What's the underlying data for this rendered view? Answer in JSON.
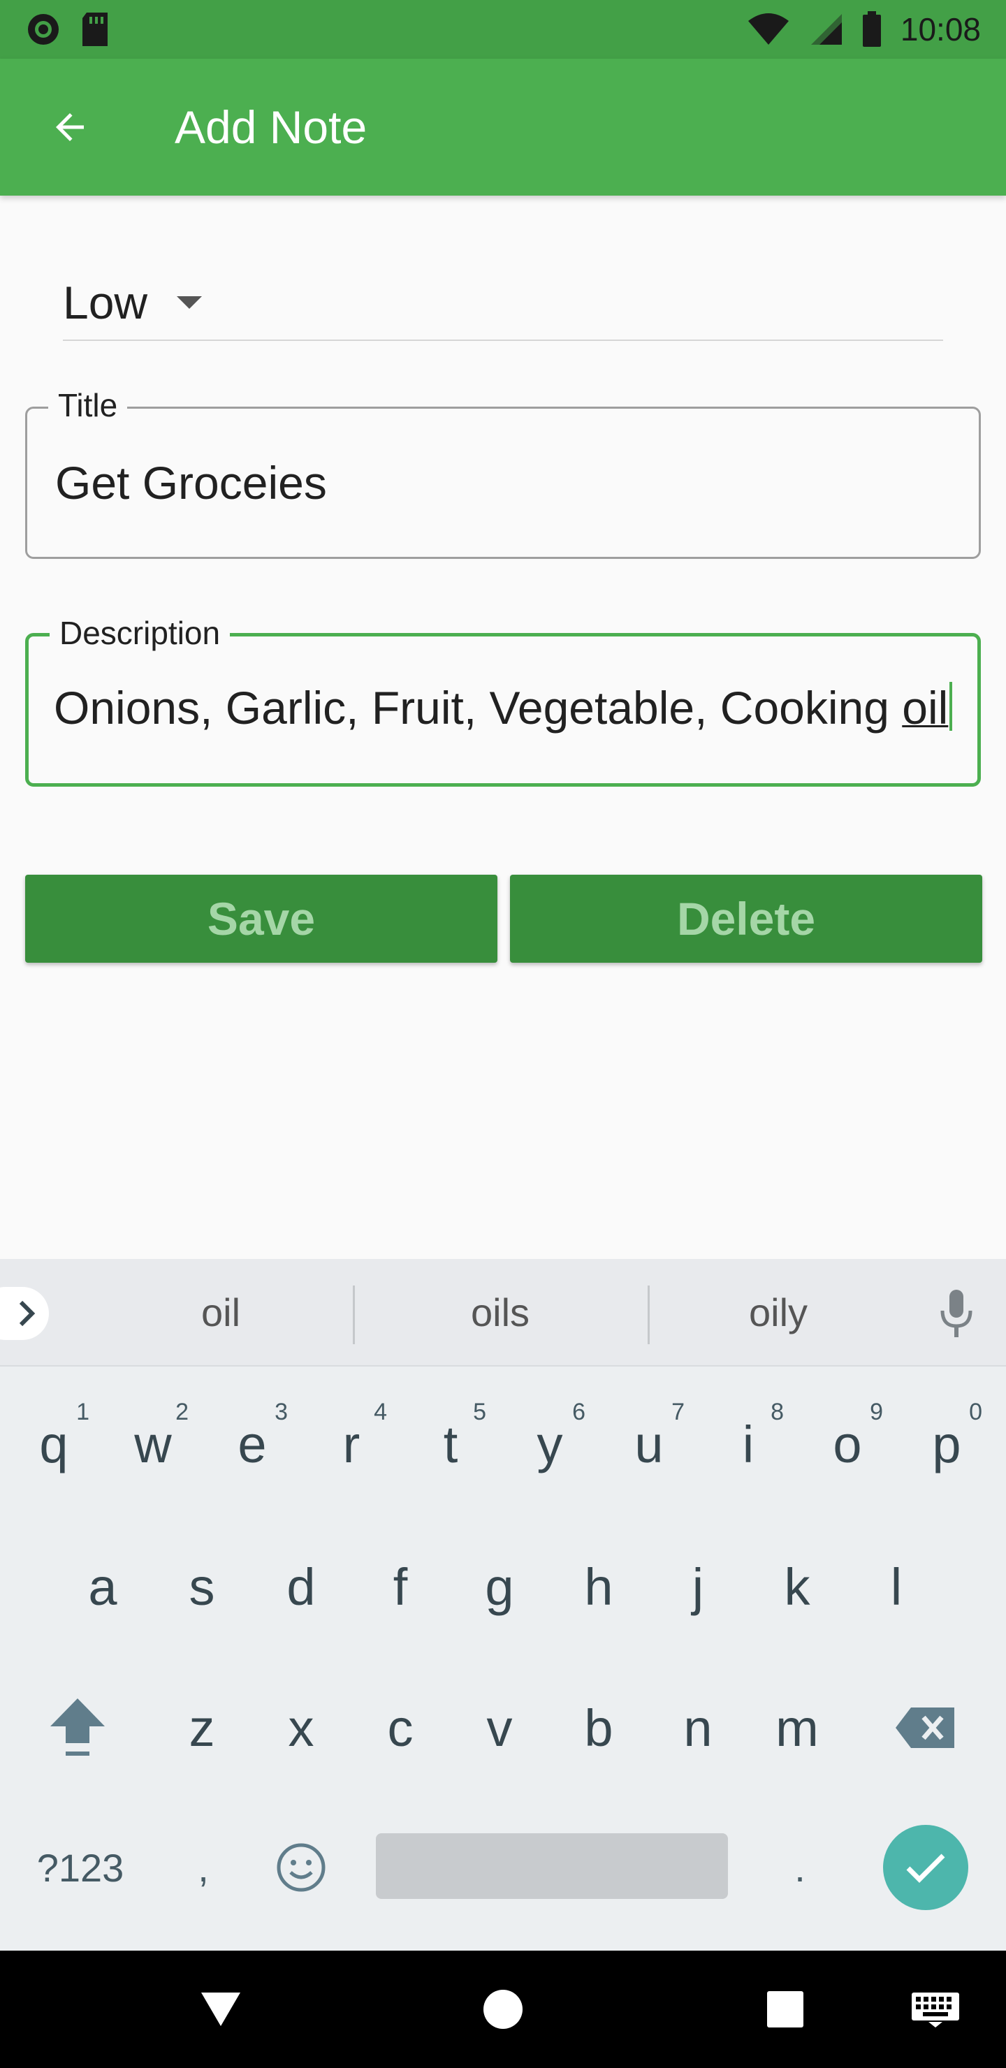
{
  "status_bar": {
    "time": "10:08"
  },
  "app_bar": {
    "title": "Add Note"
  },
  "priority": {
    "selected": "Low"
  },
  "title_field": {
    "label": "Title",
    "value": "Get Groceies"
  },
  "description_field": {
    "label": "Description",
    "value_plain": "Onions, Garlic, Fruit, Vegetable, Cooking ",
    "value_underlined": "oil"
  },
  "buttons": {
    "save": "Save",
    "delete": "Delete"
  },
  "keyboard": {
    "suggestions": [
      "oil",
      "oils",
      "oily"
    ],
    "row1": [
      {
        "key": "q",
        "hint": "1"
      },
      {
        "key": "w",
        "hint": "2"
      },
      {
        "key": "e",
        "hint": "3"
      },
      {
        "key": "r",
        "hint": "4"
      },
      {
        "key": "t",
        "hint": "5"
      },
      {
        "key": "y",
        "hint": "6"
      },
      {
        "key": "u",
        "hint": "7"
      },
      {
        "key": "i",
        "hint": "8"
      },
      {
        "key": "o",
        "hint": "9"
      },
      {
        "key": "p",
        "hint": "0"
      }
    ],
    "row2": [
      "a",
      "s",
      "d",
      "f",
      "g",
      "h",
      "j",
      "k",
      "l"
    ],
    "row3": [
      "z",
      "x",
      "c",
      "v",
      "b",
      "n",
      "m"
    ],
    "symbols_label": "?123",
    "comma": ",",
    "period": "."
  },
  "colors": {
    "primary": "#4caf50",
    "primary_dark": "#43a047",
    "button": "#388e3c",
    "button_text": "#a5d6a7",
    "accent": "#4db6ac"
  }
}
